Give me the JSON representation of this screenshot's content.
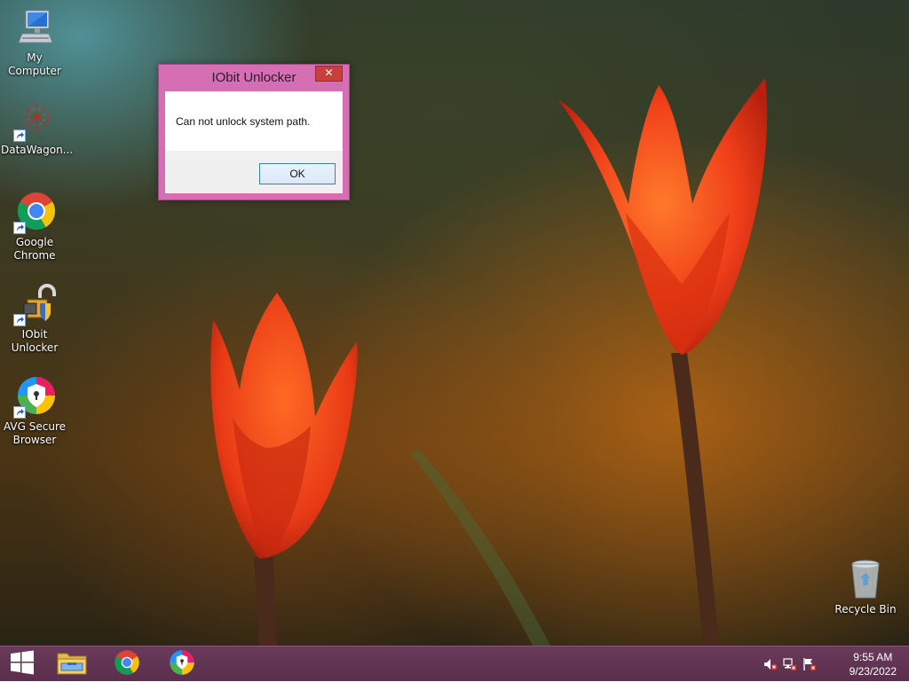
{
  "desktop": {
    "icons": [
      {
        "label": "My Computer"
      },
      {
        "label": "DataWagon..."
      },
      {
        "label": "Google Chrome"
      },
      {
        "label": "IObit Unlocker"
      },
      {
        "label": "AVG Secure Browser"
      },
      {
        "label": "Recycle Bin"
      }
    ]
  },
  "dialog": {
    "title": "IObit Unlocker",
    "close_label": "✕",
    "message": "Can not unlock system path.",
    "ok_label": "OK"
  },
  "taskbar": {
    "start_icon": "windows-logo-icon",
    "pinned": [
      {
        "name": "file-explorer-icon"
      },
      {
        "name": "google-chrome-icon"
      },
      {
        "name": "avg-secure-browser-icon"
      }
    ],
    "tray_icons": [
      "volume-muted-icon",
      "network-icon",
      "action-center-flag-icon"
    ],
    "clock": {
      "time": "9:55 AM",
      "date": "9/23/2022"
    }
  },
  "colors": {
    "taskbar": "#5a2e4c",
    "dialog_frame": "#d66eb4",
    "close_button": "#c7403b",
    "ok_border": "#3c7fb1"
  }
}
